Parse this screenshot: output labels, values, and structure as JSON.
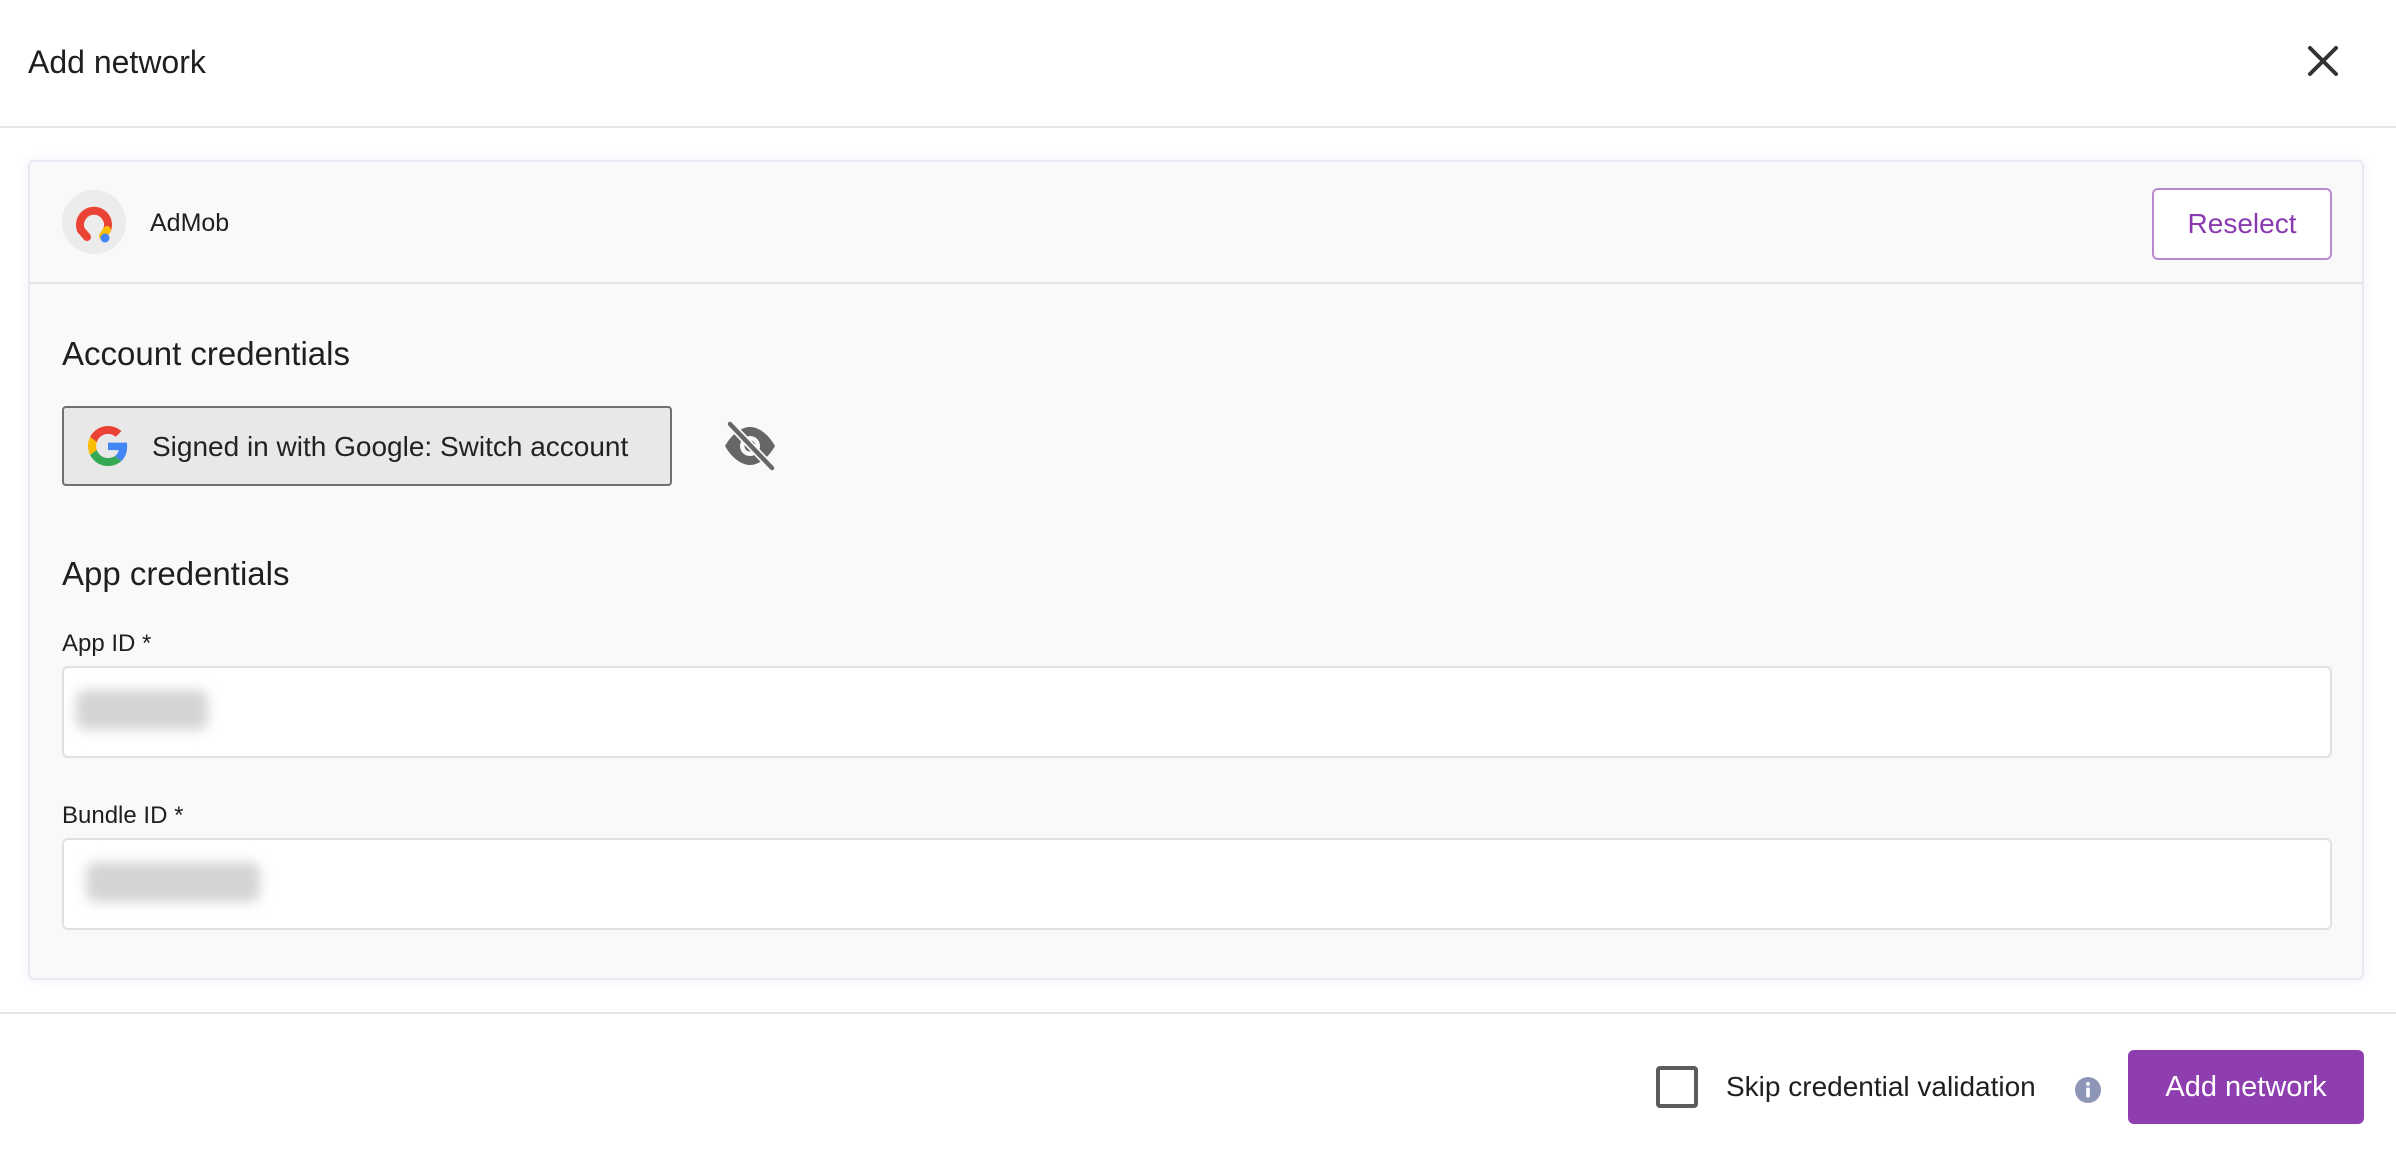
{
  "modal": {
    "title": "Add network",
    "close_icon": "close-icon"
  },
  "network": {
    "name": "AdMob",
    "logo_icon": "admob-logo",
    "reselect_label": "Reselect"
  },
  "account_credentials": {
    "title": "Account credentials",
    "google_button_label": "Signed in with Google: Switch account",
    "google_icon": "google-icon",
    "visibility_icon": "eye-off-icon"
  },
  "app_credentials": {
    "title": "App credentials",
    "app_id": {
      "label": "App ID *"
    },
    "bundle_id": {
      "label": "Bundle ID *"
    }
  },
  "footer": {
    "skip_label": "Skip credential validation",
    "skip_checked": false,
    "info_icon": "info-icon",
    "add_label": "Add network"
  },
  "colors": {
    "accent": "#8e3eaf",
    "accent_border": "#b98ad2",
    "card_background": "#f9f9f9"
  }
}
